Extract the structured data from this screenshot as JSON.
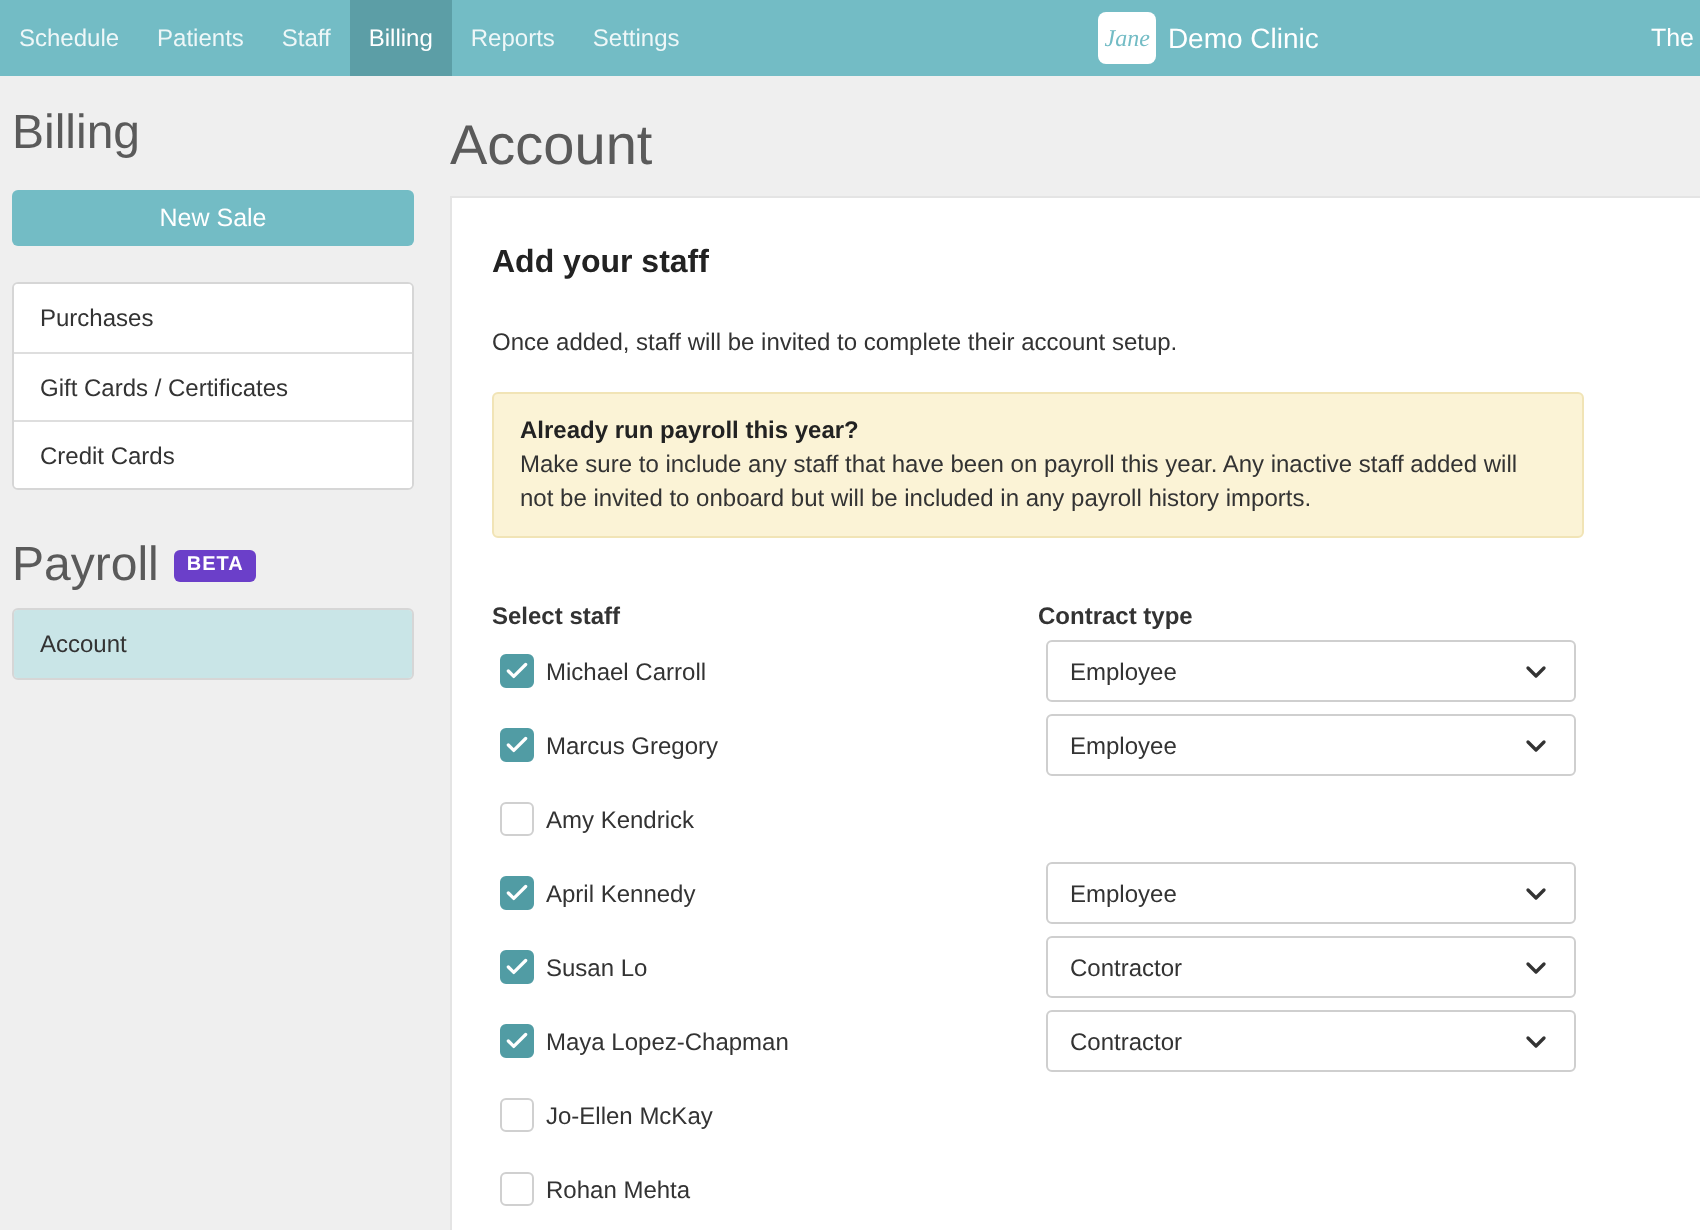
{
  "nav": {
    "tabs": [
      {
        "label": "Schedule",
        "selected": false
      },
      {
        "label": "Patients",
        "selected": false
      },
      {
        "label": "Staff",
        "selected": false
      },
      {
        "label": "Billing",
        "selected": true
      },
      {
        "label": "Reports",
        "selected": false
      },
      {
        "label": "Settings",
        "selected": false
      }
    ],
    "brand": {
      "logo_text": "Jane",
      "name": "Demo Clinic"
    },
    "right_text": "The"
  },
  "sidebar": {
    "sections": [
      {
        "title": "Billing",
        "button": "New Sale",
        "items": [
          {
            "label": "Purchases",
            "selected": false
          },
          {
            "label": "Gift Cards / Certificates",
            "selected": false
          },
          {
            "label": "Credit Cards",
            "selected": false
          }
        ]
      },
      {
        "title": "Payroll",
        "badge": "BETA",
        "items": [
          {
            "label": "Account",
            "selected": true
          }
        ]
      }
    ]
  },
  "main": {
    "title": "Account",
    "panel": {
      "heading": "Add your staff",
      "description": "Once added, staff will be invited to complete their account setup.",
      "notice": {
        "title": "Already run payroll this year?",
        "body": "Make sure to include any staff that have been on payroll this year. Any inactive staff added will not be invited to onboard but will be included in any payroll history imports."
      },
      "columns": [
        "Select staff",
        "Contract type"
      ],
      "staff": [
        {
          "name": "Michael Carroll",
          "checked": true,
          "contract_type": "Employee"
        },
        {
          "name": "Marcus Gregory",
          "checked": true,
          "contract_type": "Employee"
        },
        {
          "name": "Amy Kendrick",
          "checked": false
        },
        {
          "name": "April Kennedy",
          "checked": true,
          "contract_type": "Employee"
        },
        {
          "name": "Susan Lo",
          "checked": true,
          "contract_type": "Contractor"
        },
        {
          "name": "Maya Lopez-Chapman",
          "checked": true,
          "contract_type": "Contractor"
        },
        {
          "name": "Jo-Ellen McKay",
          "checked": false
        },
        {
          "name": "Rohan Mehta",
          "checked": false
        }
      ]
    }
  }
}
